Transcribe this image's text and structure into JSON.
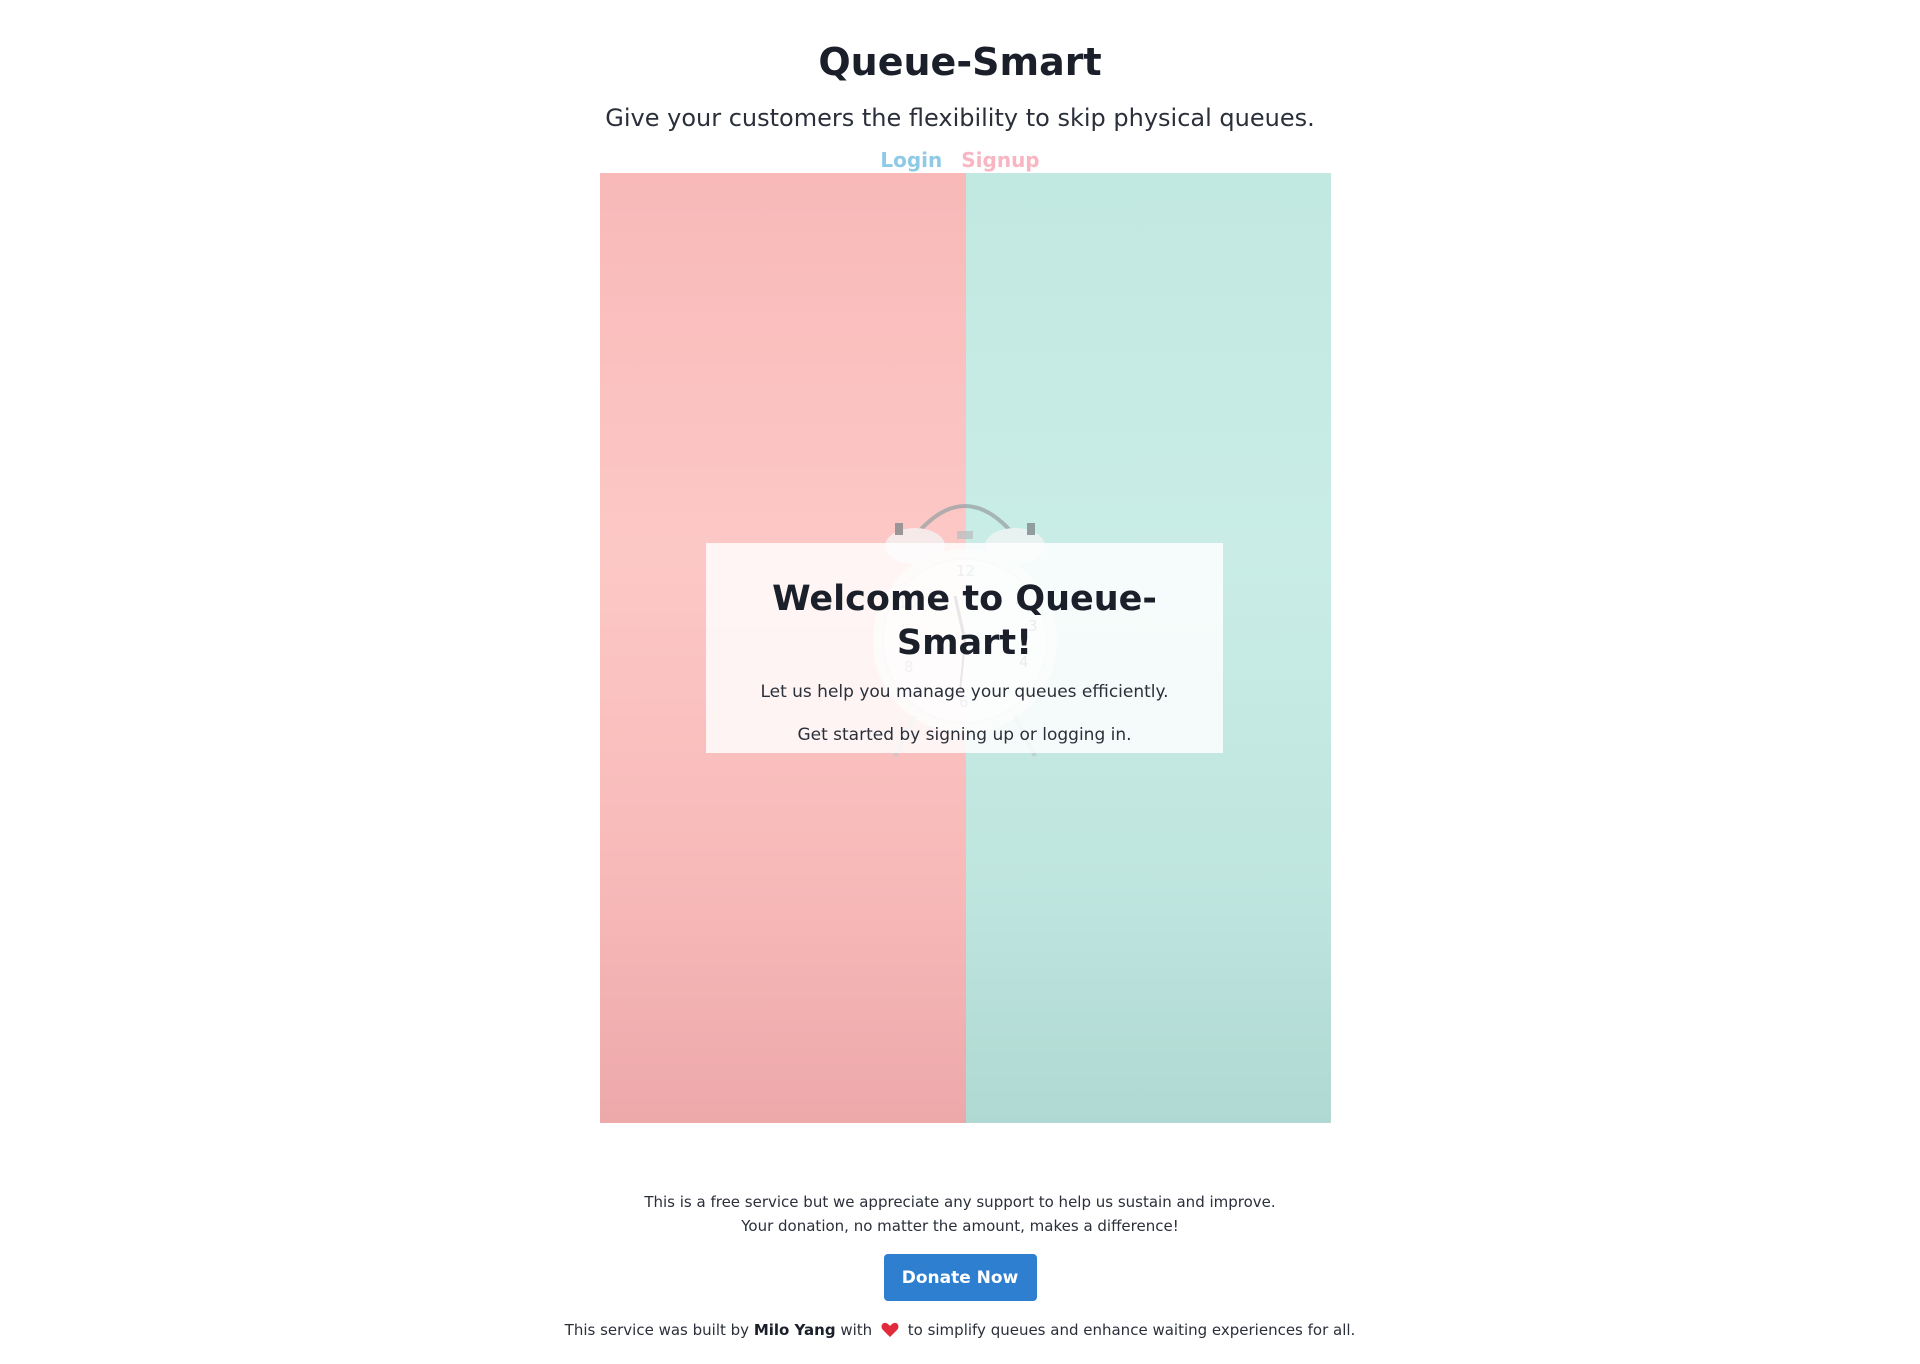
{
  "header": {
    "title": "Queue-Smart",
    "tagline": "Give your customers the flexibility to skip physical queues.",
    "login_label": "Login",
    "signup_label": "Signup"
  },
  "hero": {
    "welcome_title": "Welcome to Queue-Smart!",
    "welcome_line1": "Let us help you manage your queues efficiently.",
    "welcome_line2": "Get started by signing up or logging in."
  },
  "footer": {
    "support_line1": "This is a free service but we appreciate any support to help us sustain and improve.",
    "support_line2": "Your donation, no matter the amount, makes a difference!",
    "donate_label": "Donate Now",
    "credit_prefix": "This service was built by",
    "author": "Milo Yang",
    "credit_with": "with",
    "credit_suffix": "to simplify queues and enhance waiting experiences for all."
  },
  "colors": {
    "login": "#8ecae6",
    "signup": "#f7b6c2",
    "donate_button": "#2f7fd0",
    "heart": "#e02b3c"
  },
  "icons": {
    "heart": "heart-icon",
    "clock": "alarm-clock-image"
  }
}
